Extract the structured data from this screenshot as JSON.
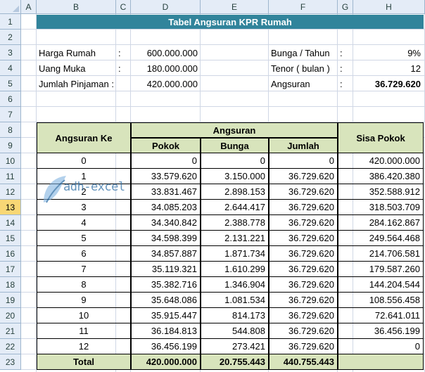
{
  "columns": [
    "A",
    "B",
    "C",
    "D",
    "E",
    "F",
    "G",
    "H"
  ],
  "rows": [
    "1",
    "2",
    "3",
    "4",
    "5",
    "6",
    "7",
    "8",
    "9",
    "10",
    "11",
    "12",
    "13",
    "14",
    "15",
    "16",
    "17",
    "18",
    "19",
    "20",
    "21",
    "22",
    "23"
  ],
  "selected_row": "13",
  "title": "Tabel Angsuran KPR Rumah",
  "info": {
    "harga_label": "Harga Rumah",
    "harga_colon": ":",
    "harga_value": "600.000.000",
    "uang_label": "Uang Muka",
    "uang_colon": ":",
    "uang_value": "180.000.000",
    "pinjaman_label": "Jumlah Pinjaman :",
    "pinjaman_value": "420.000.000",
    "bunga_label": "Bunga / Tahun",
    "bunga_colon": ":",
    "bunga_value": "9%",
    "tenor_label": "Tenor ( bulan )",
    "tenor_colon": ":",
    "tenor_value": "12",
    "angsuran_label": "Angsuran",
    "angsuran_colon": ":",
    "angsuran_value": "36.729.620"
  },
  "table": {
    "h_angsuran_ke": "Angsuran Ke",
    "h_angsuran": "Angsuran",
    "h_pokok": "Pokok",
    "h_bunga": "Bunga",
    "h_jumlah": "Jumlah",
    "h_sisa": "Sisa Pokok",
    "rows": [
      [
        "0",
        "0",
        "0",
        "0",
        "420.000.000"
      ],
      [
        "1",
        "33.579.620",
        "3.150.000",
        "36.729.620",
        "386.420.380"
      ],
      [
        "2",
        "33.831.467",
        "2.898.153",
        "36.729.620",
        "352.588.912"
      ],
      [
        "3",
        "34.085.203",
        "2.644.417",
        "36.729.620",
        "318.503.709"
      ],
      [
        "4",
        "34.340.842",
        "2.388.778",
        "36.729.620",
        "284.162.867"
      ],
      [
        "5",
        "34.598.399",
        "2.131.221",
        "36.729.620",
        "249.564.468"
      ],
      [
        "6",
        "34.857.887",
        "1.871.734",
        "36.729.620",
        "214.706.581"
      ],
      [
        "7",
        "35.119.321",
        "1.610.299",
        "36.729.620",
        "179.587.260"
      ],
      [
        "8",
        "35.382.716",
        "1.346.904",
        "36.729.620",
        "144.204.544"
      ],
      [
        "9",
        "35.648.086",
        "1.081.534",
        "36.729.620",
        "108.556.458"
      ],
      [
        "10",
        "35.915.447",
        "814.173",
        "36.729.620",
        "72.641.011"
      ],
      [
        "11",
        "36.184.813",
        "544.808",
        "36.729.620",
        "36.456.199"
      ],
      [
        "12",
        "36.456.199",
        "273.421",
        "36.729.620",
        "0"
      ]
    ],
    "total_label": "Total",
    "total_pokok": "420.000.000",
    "total_bunga": "20.755.443",
    "total_jumlah": "440.755.443"
  },
  "watermark": "adh-excel"
}
